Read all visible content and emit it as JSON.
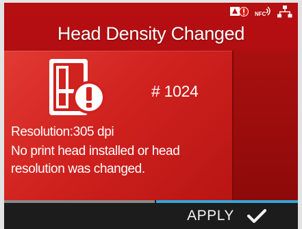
{
  "status_bar": {
    "icons": [
      "alert-icon",
      "nfc-icon",
      "network-icon"
    ]
  },
  "title": "Head Density Changed",
  "error": {
    "icon": "printer-warning-icon",
    "code": "# 1024",
    "resolution": "Resolution:305 dpi",
    "message": "No print head installed or head resolution was changed."
  },
  "footer": {
    "apply_label": "APPLY",
    "apply_icon": "check-icon"
  },
  "colors": {
    "screen_bg": "#b60f12",
    "panel_bg": "#d0221f",
    "accent_bar": "#2ea9dd",
    "footer_bg": "#1c1c1c"
  }
}
